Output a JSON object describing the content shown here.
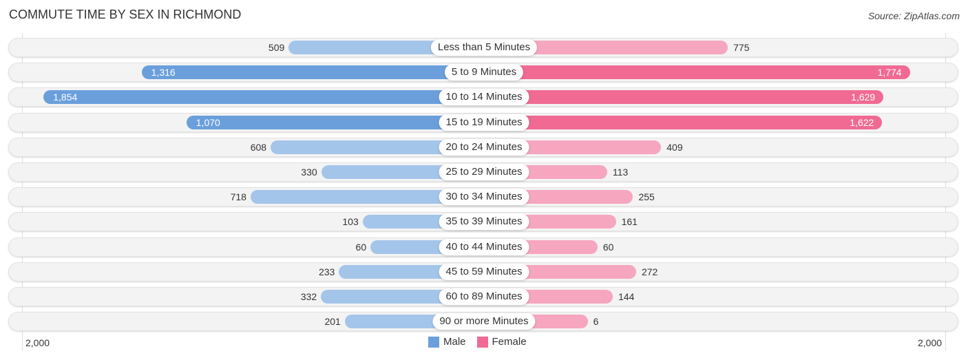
{
  "header": {
    "title": "COMMUTE TIME BY SEX IN RICHMOND",
    "source": "Source: ZipAtlas.com"
  },
  "colors": {
    "male": "#6a9fdc",
    "male_light": "#a4c5ea",
    "female": "#f06a94",
    "female_light": "#f6a6bf"
  },
  "chart_data": {
    "type": "bar",
    "orientation": "horizontal-diverging",
    "title": "COMMUTE TIME BY SEX IN RICHMOND",
    "categories": [
      "Less than 5 Minutes",
      "5 to 9 Minutes",
      "10 to 14 Minutes",
      "15 to 19 Minutes",
      "20 to 24 Minutes",
      "25 to 29 Minutes",
      "30 to 34 Minutes",
      "35 to 39 Minutes",
      "40 to 44 Minutes",
      "45 to 59 Minutes",
      "60 to 89 Minutes",
      "90 or more Minutes"
    ],
    "series": [
      {
        "name": "Male",
        "values": [
          509,
          1316,
          1854,
          1070,
          608,
          330,
          718,
          103,
          60,
          233,
          332,
          201
        ],
        "labels": [
          "509",
          "1,316",
          "1,854",
          "1,070",
          "608",
          "330",
          "718",
          "103",
          "60",
          "233",
          "332",
          "201"
        ]
      },
      {
        "name": "Female",
        "values": [
          775,
          1774,
          1629,
          1622,
          409,
          113,
          255,
          161,
          60,
          272,
          144,
          6
        ],
        "labels": [
          "775",
          "1,774",
          "1,629",
          "1,622",
          "409",
          "113",
          "255",
          "161",
          "60",
          "272",
          "144",
          "6"
        ]
      }
    ],
    "xlim": [
      -2000,
      2000
    ],
    "tick_labels": {
      "left": "2,000",
      "right": "2,000"
    },
    "legend": {
      "placement": "bottom-center",
      "entries": [
        "Male",
        "Female"
      ]
    },
    "grid": false
  }
}
